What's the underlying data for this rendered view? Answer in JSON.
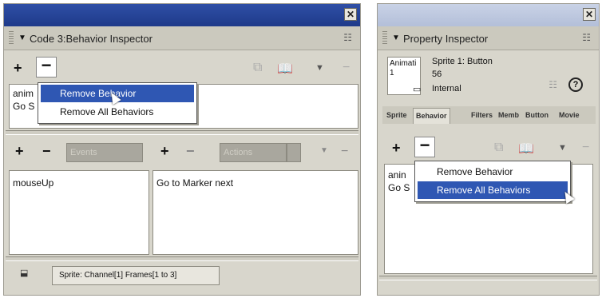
{
  "left_panel": {
    "header_title": "Code 3:Behavior Inspector",
    "toolbar": {
      "add": "+",
      "remove": "−"
    },
    "behavior_list": {
      "items": [
        "anim",
        "Go S"
      ]
    },
    "context_menu": {
      "items": [
        "Remove Behavior",
        "Remove All Behaviors"
      ],
      "highlighted_index": 0
    },
    "events": {
      "add": "+",
      "remove": "−",
      "label": "Events",
      "items": [
        "mouseUp"
      ]
    },
    "actions": {
      "add": "+",
      "remove": "−",
      "label": "Actions",
      "items": [
        "Go to Marker next"
      ]
    },
    "status": {
      "text": "Sprite:  Channel[1]  Frames[1 to 3]"
    }
  },
  "right_panel": {
    "header_title": "Property Inspector",
    "sprite_info": {
      "thumb_line1": "Animati",
      "thumb_line2": "1",
      "line1": "Sprite 1: Button",
      "line2": "56",
      "line3": "Internal"
    },
    "tabs": [
      "Sprite",
      "Behavior",
      "Filters",
      "Memb",
      "Button",
      "Movie"
    ],
    "active_tab_index": 1,
    "toolbar": {
      "add": "+",
      "remove": "−"
    },
    "behavior_list": {
      "items": [
        "anin",
        "Go S"
      ]
    },
    "context_menu": {
      "items": [
        "Remove Behavior",
        "Remove All Behaviors"
      ],
      "highlighted_index": 1
    }
  },
  "accent_colors": {
    "titlebar": "#1e3a8a",
    "highlight": "#2f57b3",
    "panel": "#d8d6cc"
  }
}
